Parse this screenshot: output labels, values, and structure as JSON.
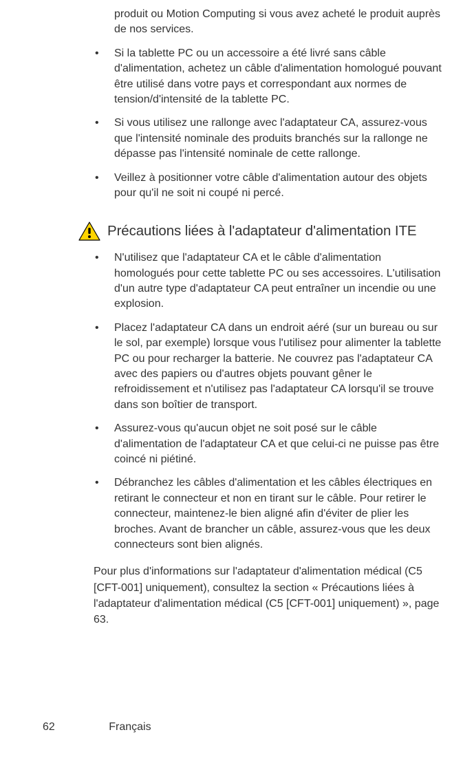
{
  "intro_fragment": "produit ou Motion Computing si vous avez acheté le produit auprès de nos services.",
  "top_bullets": [
    "Si la tablette PC ou un accessoire a été livré sans câble d'alimentation, achetez un câble d'alimentation homologué pouvant être utilisé dans votre pays et correspondant aux normes de tension/d'intensité de la tablette PC.",
    "Si vous utilisez une rallonge avec l'adaptateur CA, assurez-vous que l'intensité nominale des produits branchés sur la rallonge ne dépasse pas l'intensité nominale de cette rallonge.",
    "Veillez à positionner votre câble d'alimentation autour des objets pour qu'il ne soit ni coupé ni percé."
  ],
  "section_heading": "Précautions liées à l'adaptateur d'alimentation ITE",
  "section_bullets": [
    "N'utilisez que l'adaptateur CA et le câble d'alimentation homologués pour cette tablette PC ou ses accessoires. L'utilisation d'un autre type d'adaptateur CA peut entraîner un incendie ou une explosion.",
    "Placez l'adaptateur CA dans un endroit aéré (sur un bureau ou sur le sol, par exemple) lorsque vous l'utilisez pour alimenter la tablette PC ou pour recharger la batterie. Ne couvrez pas l'adaptateur CA avec des papiers ou d'autres objets pouvant gêner le refroidissement et n'utilisez pas l'adaptateur CA lorsqu'il se trouve dans son boîtier de transport.",
    "Assurez-vous qu'aucun objet ne soit posé sur le câble d'alimentation de l'adaptateur CA et que celui-ci ne puisse pas être coincé ni piétiné.",
    "Débranchez les câbles d'alimentation et les câbles électriques en retirant le connecteur et non en tirant sur le câble. Pour retirer le connecteur, maintenez-le bien aligné afin d'éviter de plier les broches. Avant de brancher un câble, assurez-vous que les deux connecteurs sont bien alignés."
  ],
  "closing_paragraph": "Pour plus d'informations sur l'adaptateur d'alimentation médical (C5 [CFT-001] uniquement), consultez la section « Précautions liées à l'adaptateur d'alimentation médical (C5 [CFT-001] uniquement) », page 63.",
  "footer": {
    "page_number": "62",
    "language": "Français"
  },
  "icons": {
    "warning": "warning-triangle"
  },
  "colors": {
    "warn_fill": "#ffd400",
    "warn_stroke": "#000000"
  }
}
